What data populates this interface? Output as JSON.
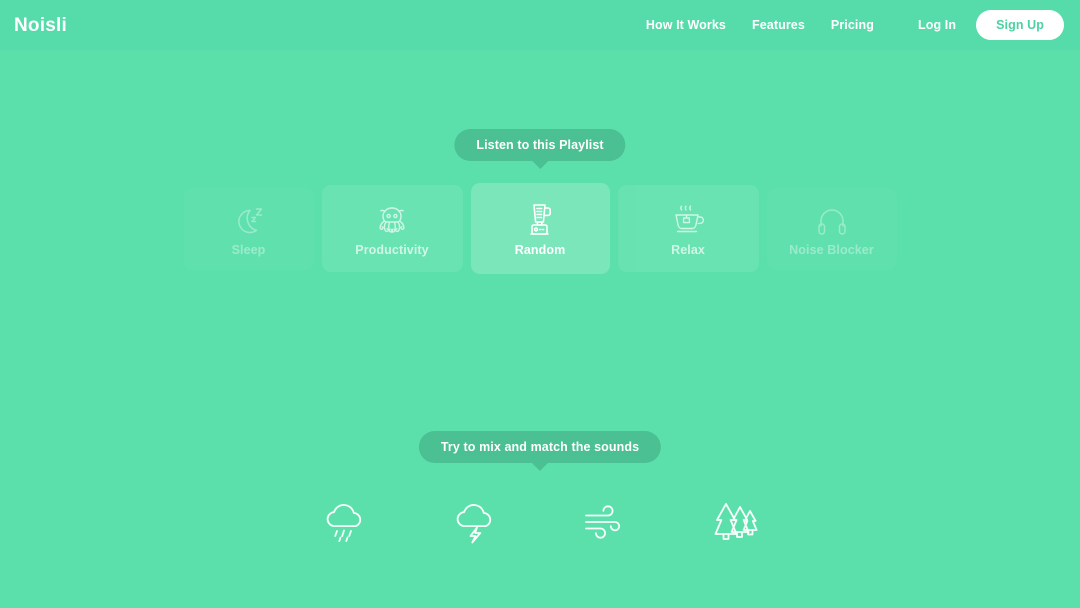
{
  "header": {
    "logo": "Noisli",
    "nav": [
      {
        "label": "How It Works",
        "name": "nav-how-it-works"
      },
      {
        "label": "Features",
        "name": "nav-features"
      },
      {
        "label": "Pricing",
        "name": "nav-pricing"
      }
    ],
    "login_label": "Log In",
    "signup_label": "Sign Up",
    "bg_color": "#56dcaa",
    "logo_color": "#ffffff",
    "signup_bg": "#ffffff",
    "signup_text_color": "#4bd2a0"
  },
  "tooltips": {
    "playlist": "Listen to this Playlist",
    "mix": "Try to mix and match the sounds",
    "bg_color": "#4ac093",
    "text_color": "#ffffff"
  },
  "playlists": {
    "selected": "Random",
    "items": [
      {
        "label": "Sleep",
        "icon": "moon-sleep-icon",
        "state": "far-left"
      },
      {
        "label": "Productivity",
        "icon": "octopus-icon",
        "state": "near-left"
      },
      {
        "label": "Random",
        "icon": "blender-icon",
        "state": "active"
      },
      {
        "label": "Relax",
        "icon": "teacup-icon",
        "state": "near-right"
      },
      {
        "label": "Noise Blocker",
        "icon": "headphones-icon",
        "state": "far-right"
      }
    ]
  },
  "sounds": {
    "items": [
      {
        "name": "Rain",
        "icon": "rain-cloud-icon"
      },
      {
        "name": "Thunderstorm",
        "icon": "thunderstorm-cloud-icon"
      },
      {
        "name": "Wind",
        "icon": "wind-icon"
      },
      {
        "name": "Forest",
        "icon": "forest-trees-icon"
      }
    ]
  },
  "theme": {
    "background": "#5ce0ab",
    "accent": "#4ac093",
    "foreground": "#ffffff"
  }
}
